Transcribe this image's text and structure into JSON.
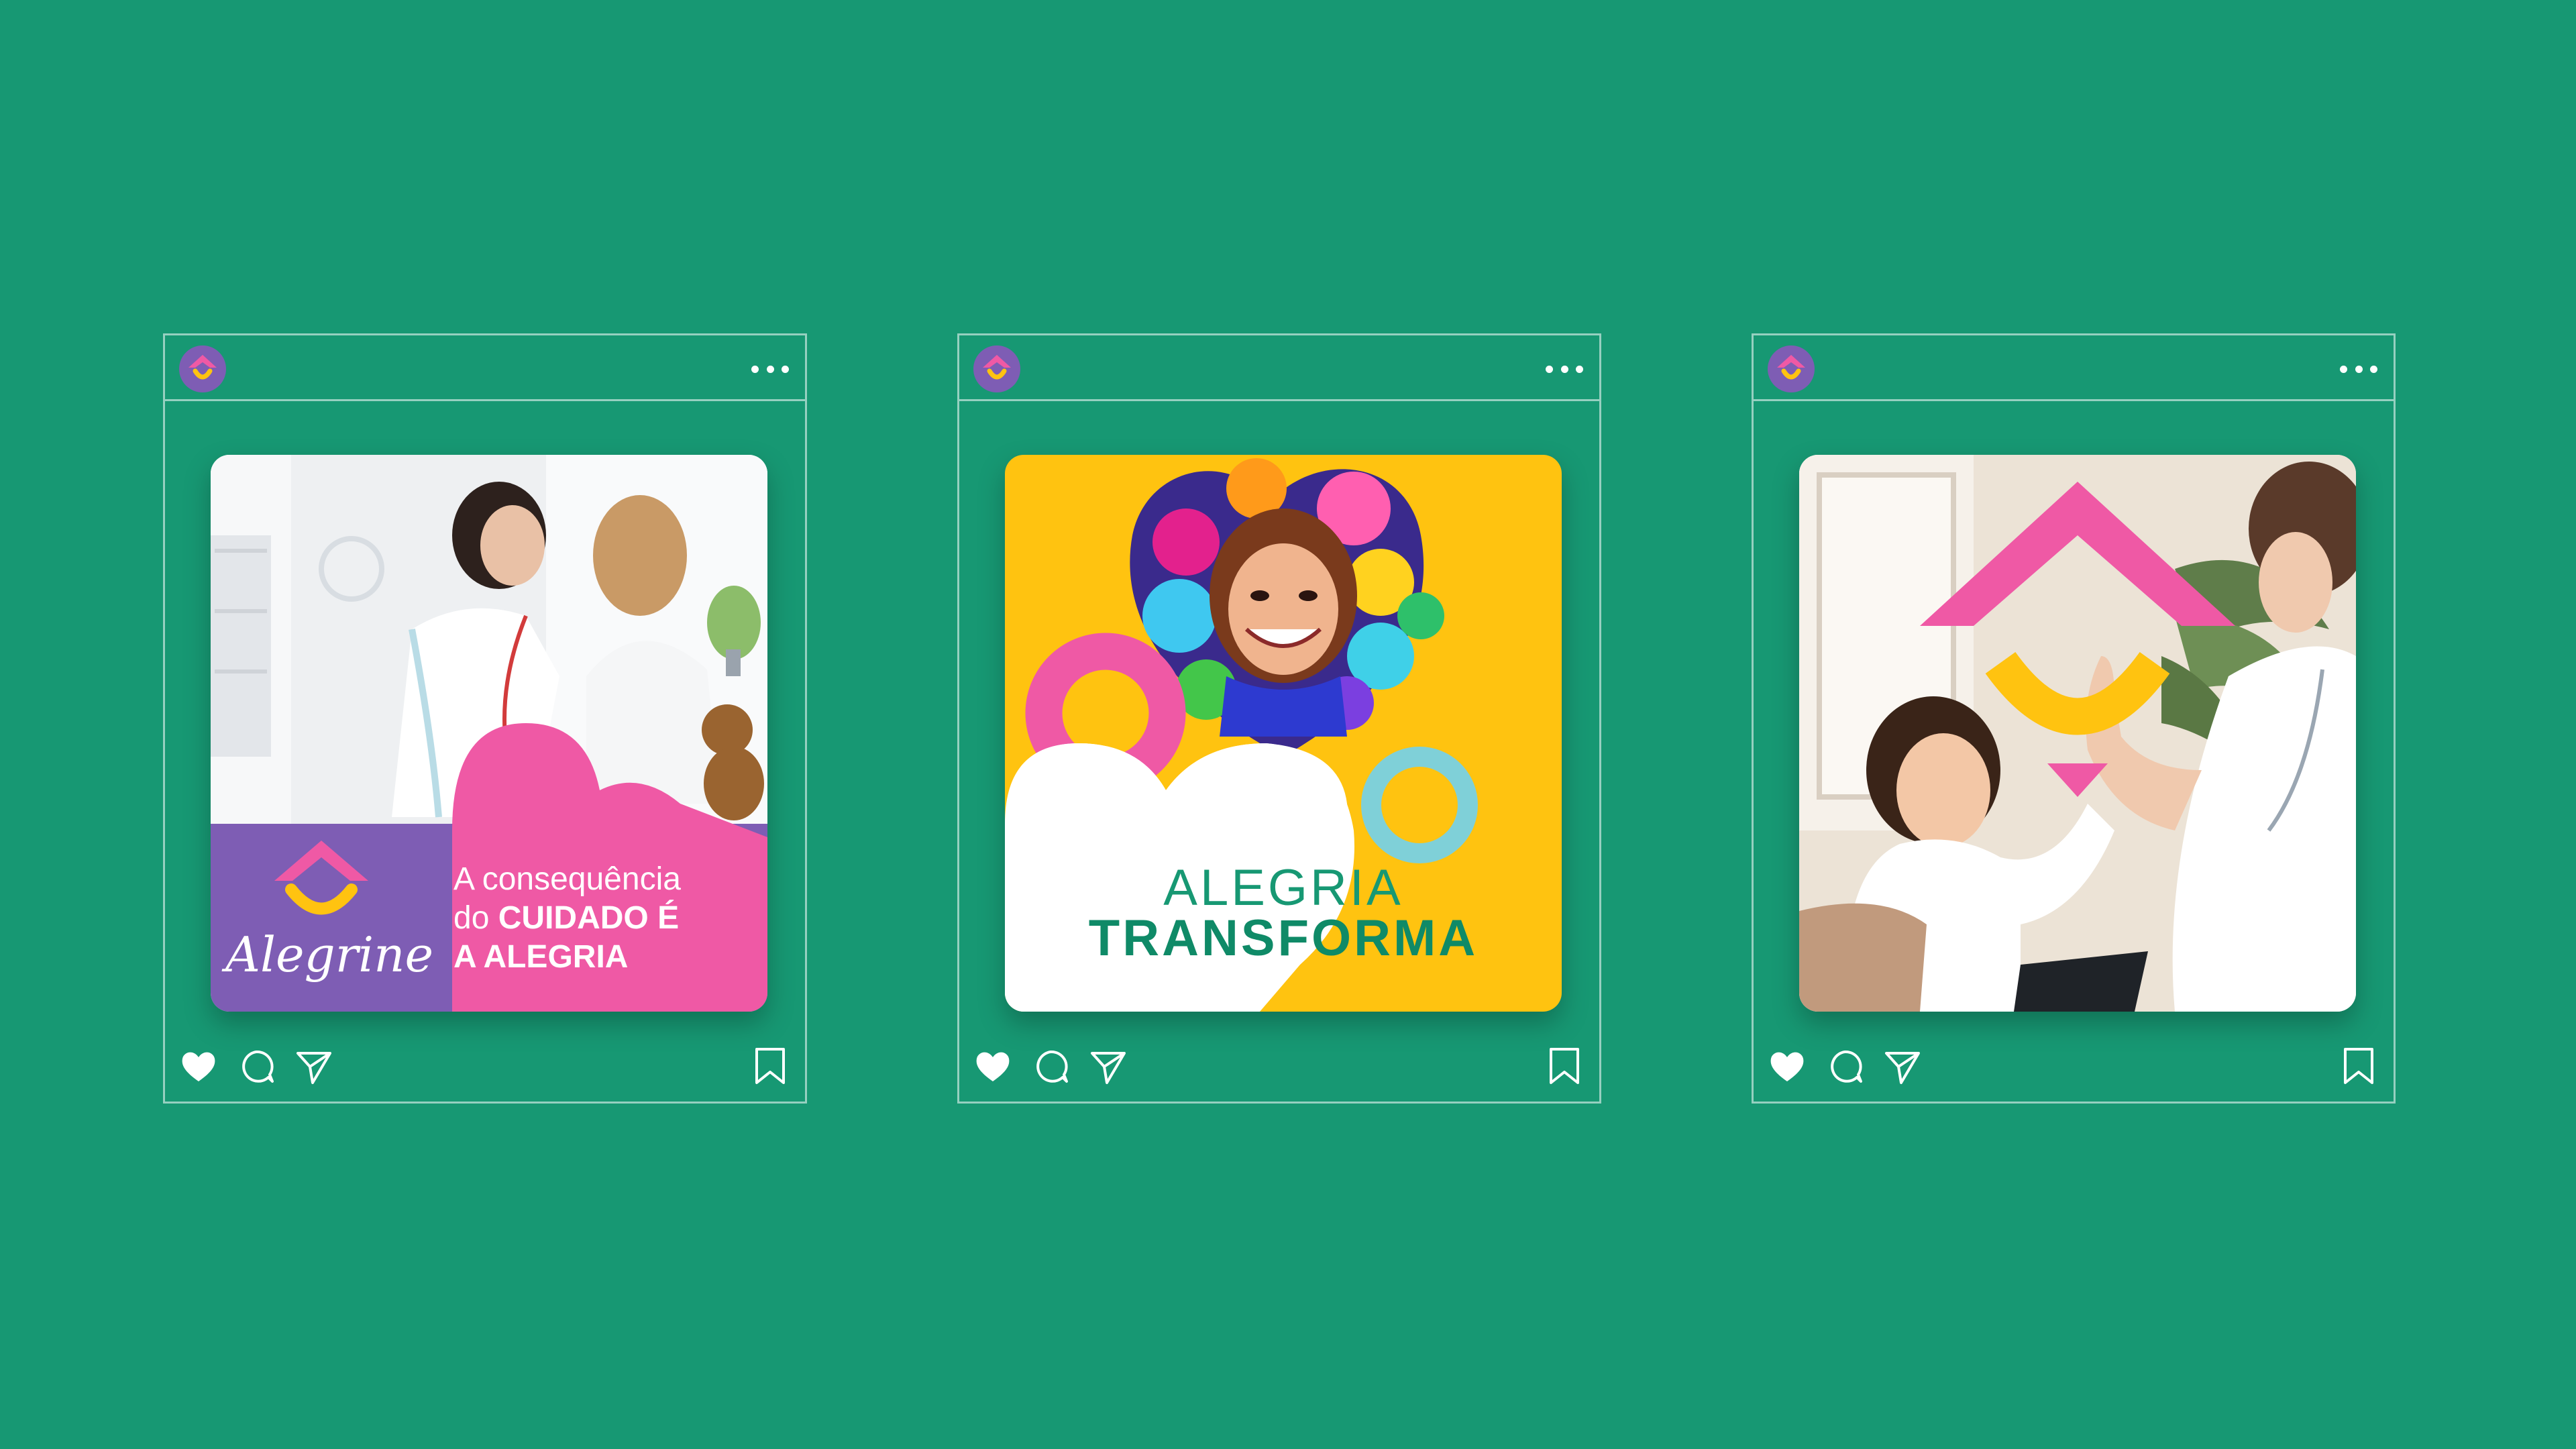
{
  "posts": [
    {
      "brand_name": "Alegrine",
      "caption_line1": "A consequência",
      "caption_line2_prefix": "do ",
      "caption_line2_bold": "CUIDADO É",
      "caption_line3_bold": "A ALEGRIA"
    },
    {
      "headline_line1": "ALEGRIA",
      "headline_line2": "TRANSFORMA"
    },
    {}
  ],
  "icons": [
    "avatar-logo-icon",
    "more-options-icon",
    "heart-icon",
    "comment-icon",
    "share-icon",
    "bookmark-icon"
  ],
  "colors": {
    "background": "#179873",
    "brand_pink": "#ef59a5",
    "brand_purple": "#7e5db4",
    "brand_yellow": "#ffc310",
    "brand_teal": "#7fd0d8",
    "brand_green": "#0f8a67"
  }
}
